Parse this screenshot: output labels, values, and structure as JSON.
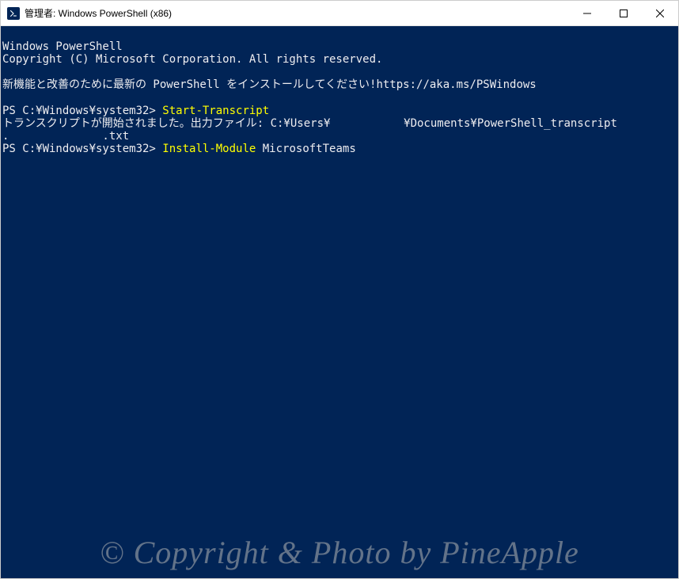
{
  "window": {
    "title": "管理者: Windows PowerShell (x86)"
  },
  "terminal": {
    "lines": {
      "l1": "Windows PowerShell",
      "l2": "Copyright (C) Microsoft Corporation. All rights reserved.",
      "l3": "",
      "l4": "新機能と改善のために最新の PowerShell をインストールしてください!https://aka.ms/PSWindows",
      "l5": "",
      "prompt1": "PS C:¥Windows¥system32> ",
      "cmd1": "Start-Transcript",
      "l6a": "トランスクリプトが開始されました。出力ファイル: C:¥Users¥           ¥Documents¥PowerShell_transcript",
      "l6b": ".              .txt",
      "prompt2": "PS C:¥Windows¥system32> ",
      "cmd2": "Install-Module",
      "arg2": " MicrosoftTeams"
    }
  },
  "watermark": "© Copyright & Photo by PineApple",
  "icons": {
    "powershell": "powershell-icon",
    "minimize": "minimize-icon",
    "maximize": "maximize-icon",
    "close": "close-icon"
  }
}
